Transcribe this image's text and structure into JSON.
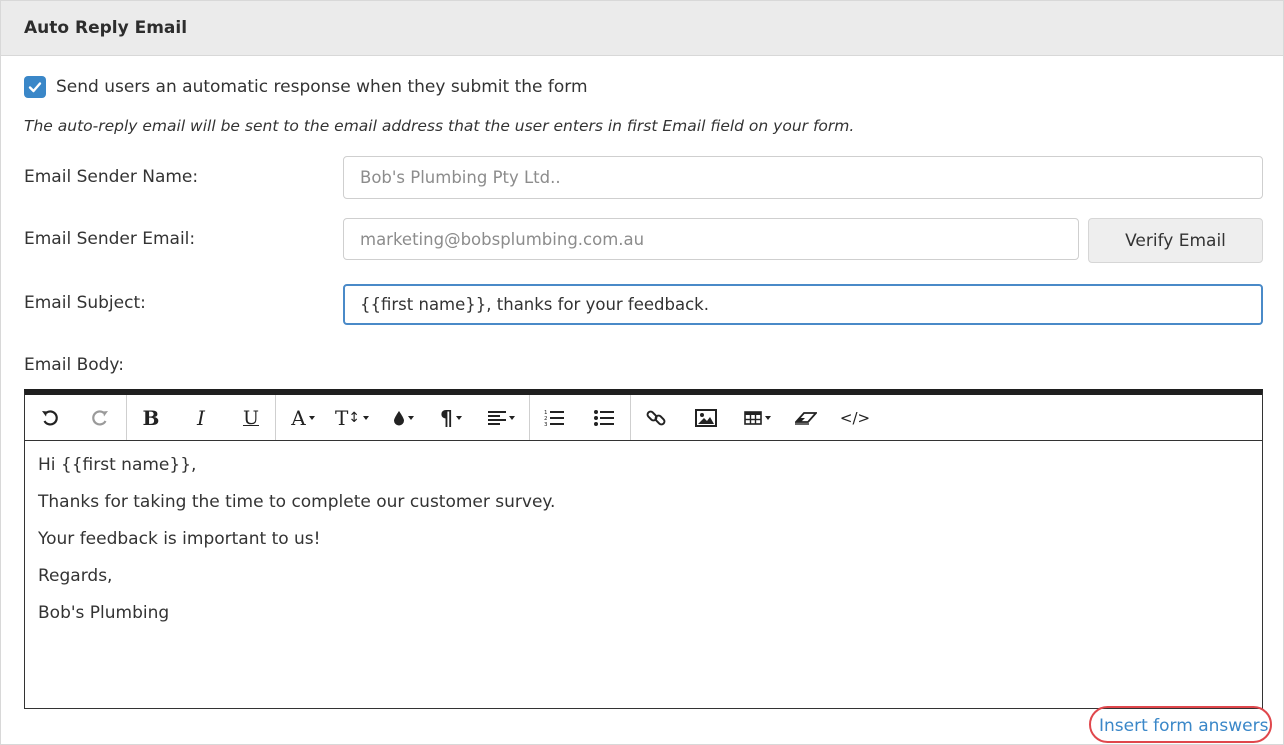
{
  "panel": {
    "title": "Auto Reply Email"
  },
  "auto_reply": {
    "checkbox_label": "Send users an automatic response when they submit the form",
    "checked": true,
    "note": "The auto-reply email will be sent to the email address that the user enters in first Email field on your form."
  },
  "form": {
    "sender_name": {
      "label": "Email Sender Name:",
      "placeholder": "Bob's Plumbing Pty Ltd..",
      "value": ""
    },
    "sender_email": {
      "label": "Email Sender Email:",
      "placeholder": "marketing@bobsplumbing.com.au",
      "value": ""
    },
    "verify_button": "Verify Email",
    "subject": {
      "label": "Email Subject:",
      "value": "{{first name}}, thanks for your feedback."
    },
    "body_label": "Email Body:"
  },
  "editor": {
    "toolbar": [
      {
        "name": "undo-icon",
        "enabled": true
      },
      {
        "name": "redo-icon",
        "enabled": false
      },
      {
        "name": "bold-icon",
        "enabled": true
      },
      {
        "name": "italic-icon",
        "enabled": true
      },
      {
        "name": "underline-icon",
        "enabled": true
      },
      {
        "name": "font-name-icon",
        "enabled": true
      },
      {
        "name": "font-size-icon",
        "enabled": true
      },
      {
        "name": "text-color-icon",
        "enabled": true
      },
      {
        "name": "paragraph-style-icon",
        "enabled": true
      },
      {
        "name": "align-icon",
        "enabled": true
      },
      {
        "name": "ordered-list-icon",
        "enabled": true
      },
      {
        "name": "unordered-list-icon",
        "enabled": true
      },
      {
        "name": "link-icon",
        "enabled": true
      },
      {
        "name": "image-icon",
        "enabled": true
      },
      {
        "name": "table-icon",
        "enabled": true
      },
      {
        "name": "eraser-icon",
        "enabled": true
      },
      {
        "name": "code-view-icon",
        "enabled": true
      }
    ],
    "toolbar_glyphs": {
      "bold": "B",
      "italic": "I",
      "underline": "U",
      "font_name": "A",
      "font_size": "T",
      "paragraph": "¶",
      "code": "</>"
    },
    "body_lines": [
      "Hi {{first name}},",
      "Thanks for taking the time to complete our customer survey.",
      "Your feedback is important to us!",
      "Regards,",
      "Bob's Plumbing"
    ]
  },
  "insert_link": "Insert form answers",
  "colors": {
    "accent": "#3a87c8",
    "highlight_ring": "#e0474c",
    "header_bg": "#ebebeb"
  }
}
